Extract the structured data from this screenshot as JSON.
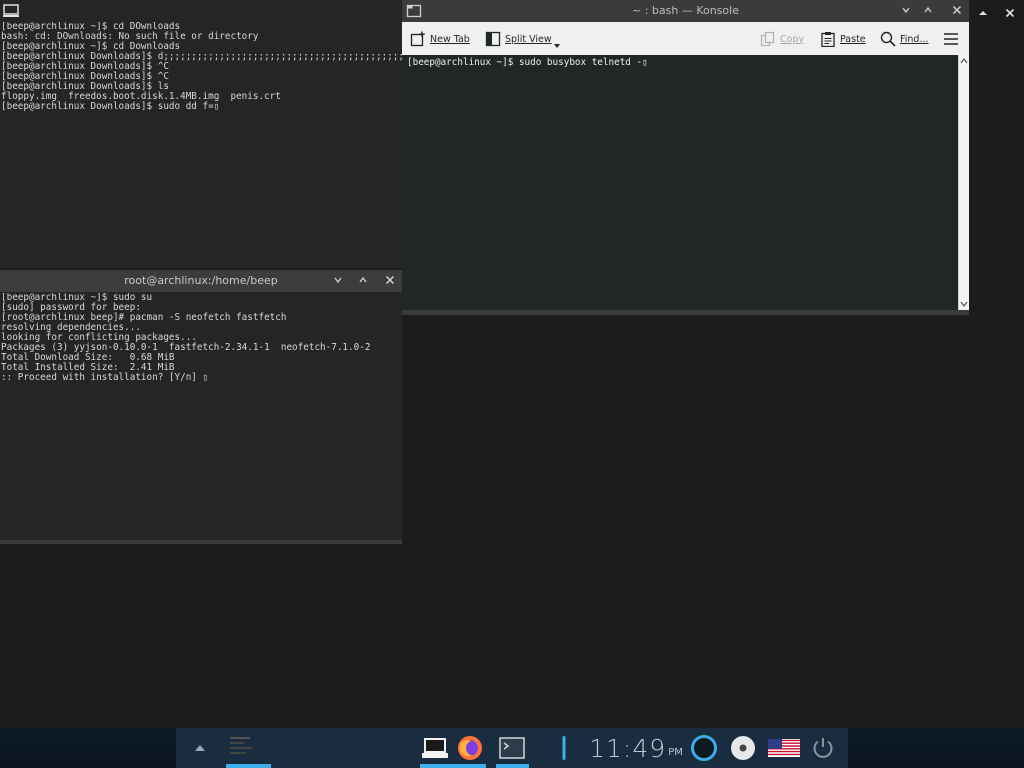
{
  "window_a": {
    "lines": [
      "[beep@archlinux ~]$ cd DOwnloads",
      "bash: cd: DOwnloads: No such file or directory",
      "[beep@archlinux ~]$ cd Downloads",
      "[beep@archlinux Downloads]$ d;;;;;;;;;;;;;;;;;;;;;;;;;;;;;;;;;;;;;;;;;;;;;;;;;;;;;;;;;;;;;;",
      "[beep@archlinux Downloads]$ ^C",
      "[beep@archlinux Downloads]$ ^C",
      "[beep@archlinux Downloads]$ ls",
      "floppy.img  freedos.boot.disk.1.4MB.img  penis.crt",
      "[beep@archlinux Downloads]$ sudo dd f=▯"
    ]
  },
  "window_b": {
    "title": "root@archlinux:/home/beep",
    "lines": [
      "[beep@archlinux ~]$ sudo su",
      "[sudo] password for beep:",
      "[root@archlinux beep]# pacman -S neofetch fastfetch",
      "resolving dependencies...",
      "looking for conflicting packages...",
      "",
      "Packages (3) yyjson-0.10.0-1  fastfetch-2.34.1-1  neofetch-7.1.0-2",
      "",
      "Total Download Size:   0.68 MiB",
      "Total Installed Size:  2.41 MiB",
      "",
      ":: Proceed with installation? [Y/n] ▯"
    ]
  },
  "konsole": {
    "title": "~ : bash — Konsole",
    "toolbar": {
      "new_tab": "New Tab",
      "split_view": "Split View",
      "copy": "Copy",
      "paste": "Paste",
      "find": "Find..."
    },
    "lines": [
      "[beep@archlinux ~]$ sudo busybox telnetd -▯"
    ]
  },
  "taskbar": {
    "clock": "11:49",
    "ampm": "PM"
  },
  "colors": {
    "accent": "#3daee9",
    "terminal_bg": "#252525",
    "konsole_bg": "#232627"
  }
}
